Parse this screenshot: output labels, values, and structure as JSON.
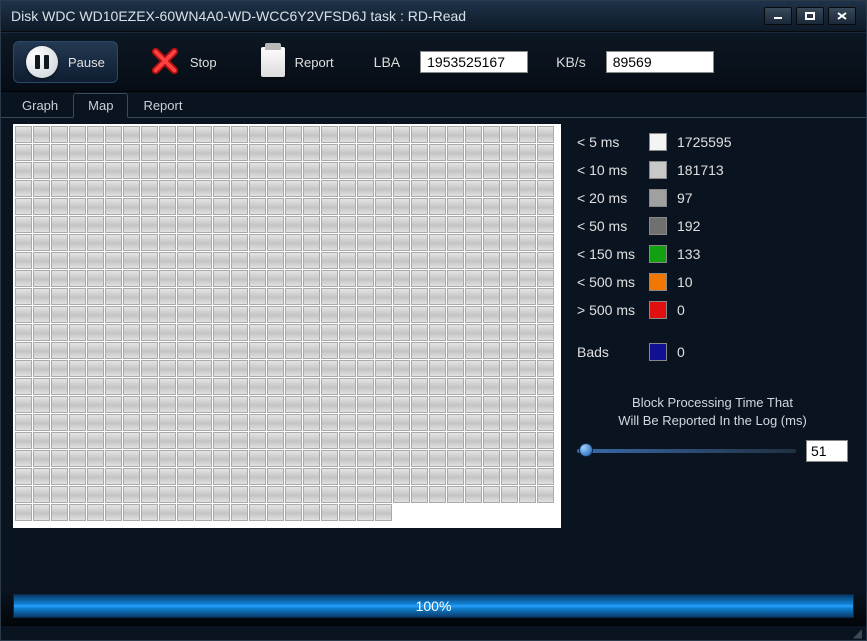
{
  "title": "Disk WDC WD10EZEX-60WN4A0-WD-WCC6Y2VFSD6J   task : RD-Read",
  "toolbar": {
    "pause_label": "Pause",
    "stop_label": "Stop",
    "report_label": "Report",
    "lba_label": "LBA",
    "lba_value": "1953525167",
    "kbs_label": "KB/s",
    "kbs_value": "89569"
  },
  "tabs": {
    "graph": "Graph",
    "map": "Map",
    "report": "Report",
    "active": "map"
  },
  "map": {
    "cols": 30,
    "full_rows": 21,
    "partial_row_cols": 21
  },
  "legend": [
    {
      "label": "< 5 ms",
      "color": "#f4f4f4",
      "count": "1725595"
    },
    {
      "label": "< 10 ms",
      "color": "#c8c8c8",
      "count": "181713"
    },
    {
      "label": "< 20 ms",
      "color": "#a0a0a0",
      "count": "97"
    },
    {
      "label": "< 50 ms",
      "color": "#707070",
      "count": "192"
    },
    {
      "label": "< 150 ms",
      "color": "#10a010",
      "count": "133"
    },
    {
      "label": "< 500 ms",
      "color": "#f07800",
      "count": "10"
    },
    {
      "label": "> 500 ms",
      "color": "#e01010",
      "count": "0"
    },
    {
      "label": "Bads",
      "color": "#101090",
      "count": "0"
    }
  ],
  "log_caption_line1": "Block Processing Time That",
  "log_caption_line2": "Will Be Reported In the Log (ms)",
  "log_threshold": "51",
  "progress_text": "100%"
}
